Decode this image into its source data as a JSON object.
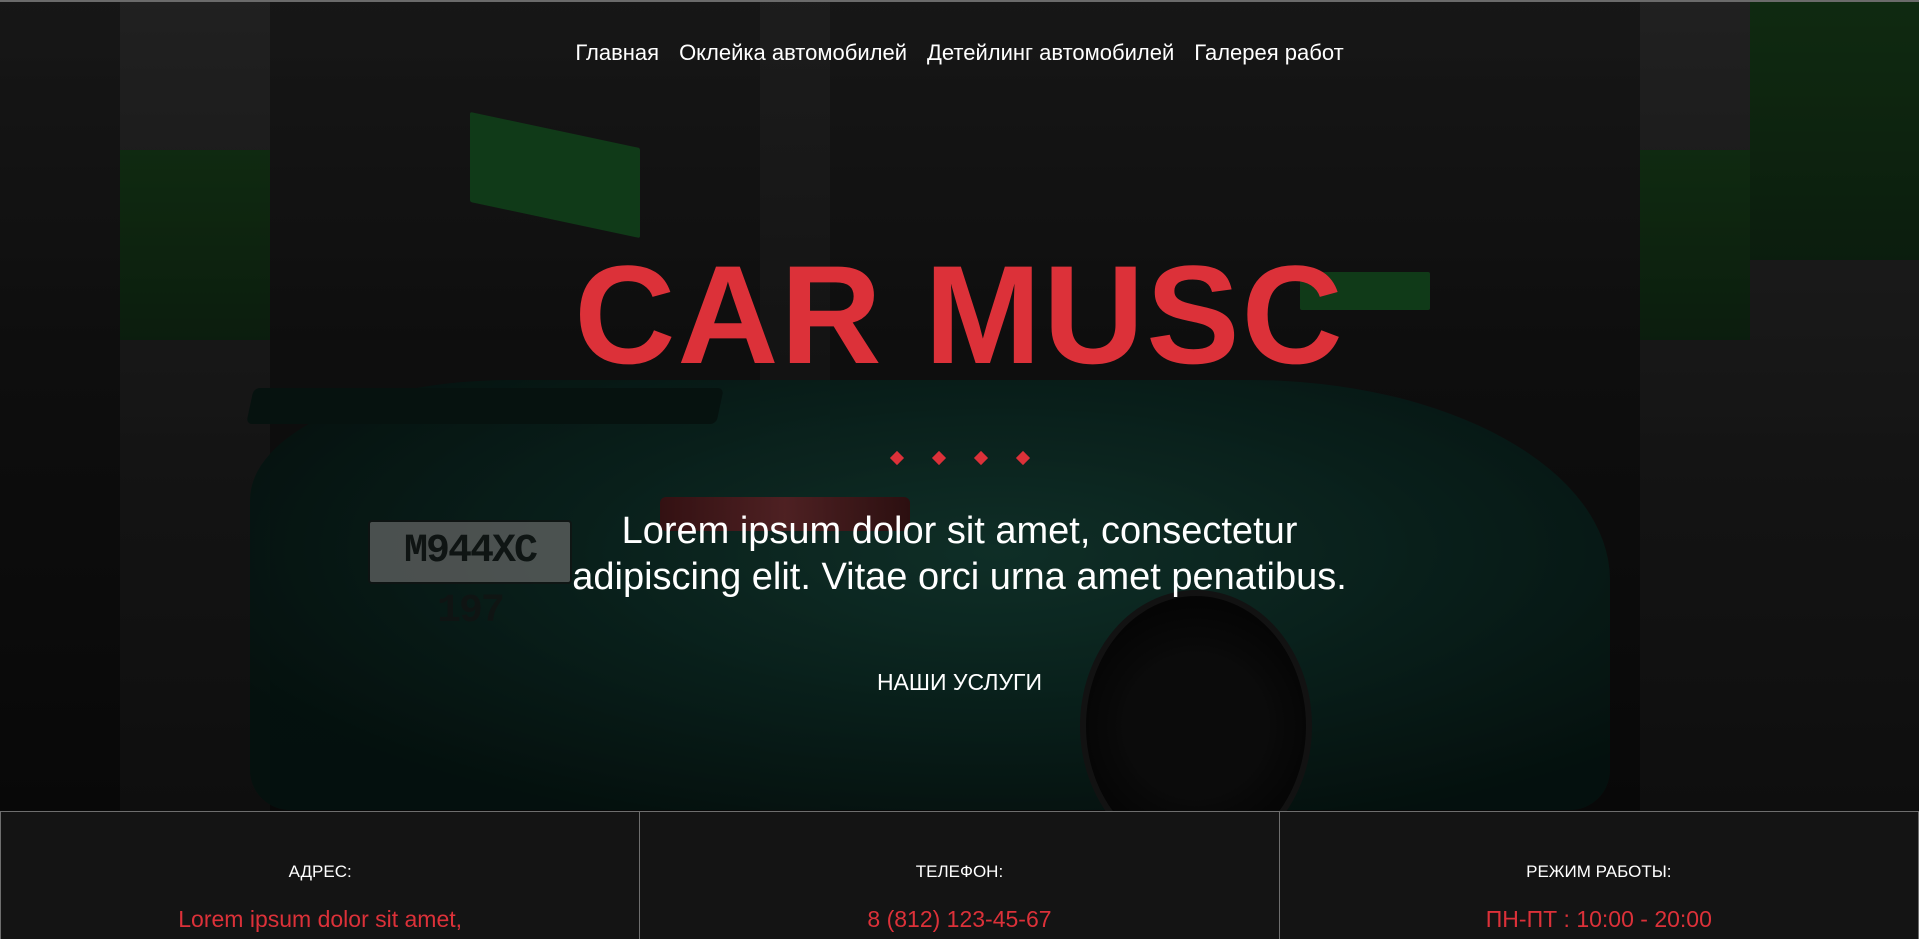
{
  "nav": {
    "items": [
      {
        "label": "Главная"
      },
      {
        "label": "Оклейка автомобилей"
      },
      {
        "label": "Детейлинг автомобилей"
      },
      {
        "label": "Галерея работ"
      }
    ]
  },
  "hero": {
    "title": "CAR MUSC",
    "lead_line1": "Lorem ipsum dolor sit amet, consectetur",
    "lead_line2": "adipiscing elit. Vitae orci urna amet penatibus.",
    "cta_label": "НАШИ УСЛУГИ",
    "plate_text": "M944XC 197"
  },
  "info": {
    "address_label": "АДРЕС:",
    "address_value": "Lorem ipsum dolor sit amet,",
    "phone_label": "ТЕЛЕФОН:",
    "phone_value": "8 (812) 123-45-67",
    "hours_label": "РЕЖИМ РАБОТЫ:",
    "hours_value": "ПН-ПТ : 10:00 - 20:00"
  },
  "colors": {
    "accent": "#dc3139",
    "text": "#ffffff",
    "background": "#141414"
  }
}
